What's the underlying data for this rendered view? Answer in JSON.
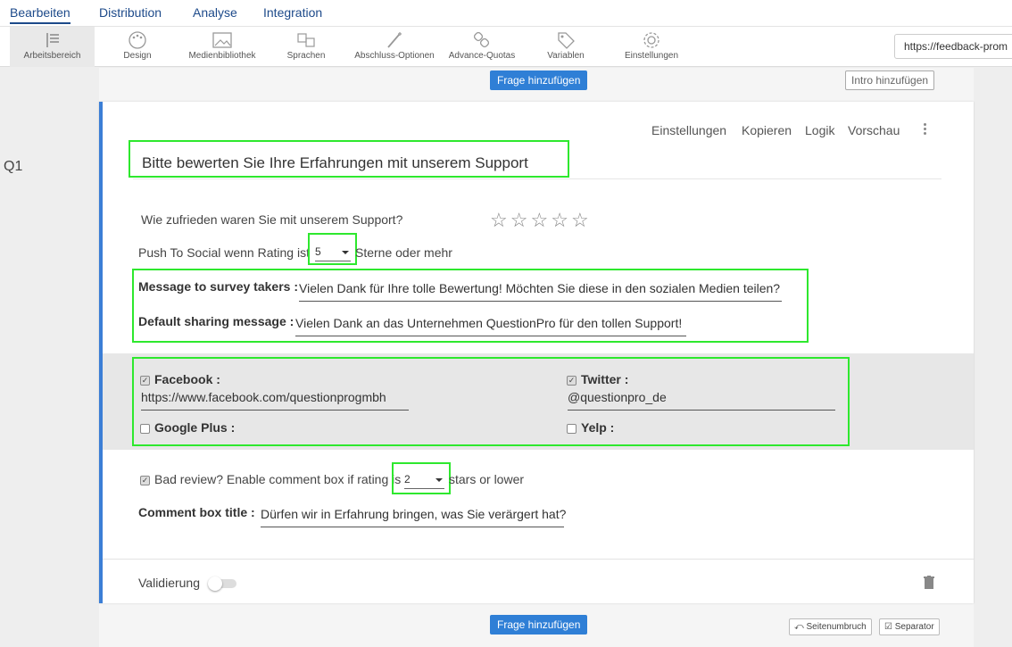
{
  "topnav": {
    "tabs": [
      "Bearbeiten",
      "Distribution",
      "Analyse",
      "Integration"
    ]
  },
  "toolbar": {
    "items": [
      {
        "label": "Arbeitsbereich",
        "icon": "workspace-icon"
      },
      {
        "label": "Design",
        "icon": "palette-icon"
      },
      {
        "label": "Medienbibliothek",
        "icon": "image-icon"
      },
      {
        "label": "Sprachen",
        "icon": "translate-icon"
      },
      {
        "label": "Abschluss-Optionen",
        "icon": "magic-wand-icon"
      },
      {
        "label": "Advance-Quotas",
        "icon": "link-icon"
      },
      {
        "label": "Variablen",
        "icon": "tag-icon"
      },
      {
        "label": "Einstellungen",
        "icon": "gear-icon"
      }
    ],
    "url": "https://feedback-prom"
  },
  "canvas": {
    "add_question_top": "Frage hinzufügen",
    "add_intro": "Intro hinzufügen",
    "add_question_bottom": "Frage hinzufügen",
    "page_break": "Seitenumbruch",
    "separator": "Separator"
  },
  "question": {
    "number": "Q1",
    "actions": [
      "Einstellungen",
      "Kopieren",
      "Logik",
      "Vorschau"
    ],
    "title": "Bitte bewerten Sie Ihre Erfahrungen mit unserem Support",
    "rating_question": "Wie zufrieden waren Sie mit unserem Support?",
    "star_count": 5,
    "push_prefix": "Push To Social wenn Rating ist",
    "push_value": "5",
    "push_suffix": "Sterne oder mehr",
    "message_label": "Message to survey takers :",
    "message_value": "Vielen Dank für Ihre tolle Bewertung! Möchten Sie diese in den sozialen Medien teilen?",
    "sharing_label": "Default sharing message :",
    "sharing_value": "Vielen Dank an das Unternehmen QuestionPro für den tollen Support!",
    "social": {
      "facebook_label": "Facebook :",
      "facebook_url": "https://www.facebook.com/questionprogmbh",
      "twitter_label": "Twitter :",
      "twitter_handle": "@questionpro_de",
      "google_label": "Google Plus :",
      "yelp_label": "Yelp :"
    },
    "bad_review_prefix": "Bad review? Enable comment box if rating is",
    "bad_review_value": "2",
    "bad_review_suffix": "stars or lower",
    "comment_label": "Comment box title :",
    "comment_value": "Dürfen wir in Erfahrung bringen, was Sie verärgert hat?",
    "validation_label": "Validierung"
  },
  "colors": {
    "accent": "#2f7fd6",
    "highlight": "#2ee82e",
    "card_border": "#3b7ed6"
  }
}
